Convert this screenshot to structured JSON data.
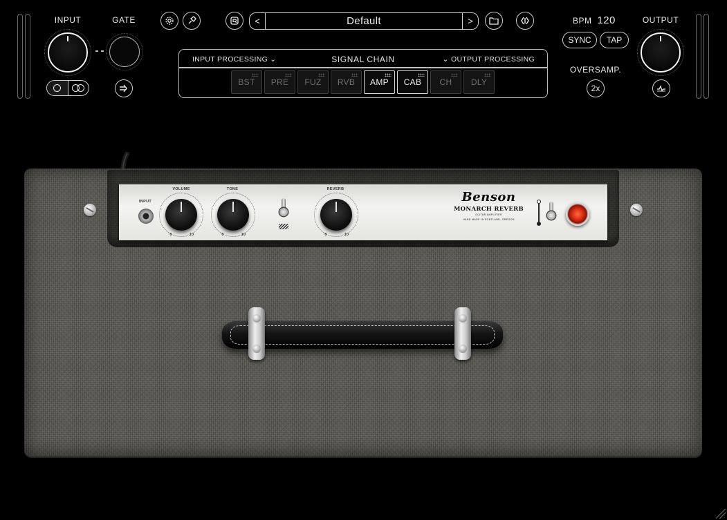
{
  "header": {
    "input_label": "INPUT",
    "gate_label": "GATE",
    "output_label": "OUTPUT",
    "bpm_label": "BPM",
    "bpm_value": "120",
    "sync_label": "SYNC",
    "tap_label": "TAP",
    "oversamp_label": "OVERSAMP.",
    "oversamp_value": "2x"
  },
  "preset": {
    "name": "Default",
    "prev_glyph": "<",
    "next_glyph": ">"
  },
  "signal_chain": {
    "title": "SIGNAL CHAIN",
    "input_processing_label": "INPUT PROCESSING ⌄",
    "output_processing_label": "⌄ OUTPUT PROCESSING",
    "modules": [
      {
        "label": "BST",
        "active": false
      },
      {
        "label": "PRE",
        "active": false
      },
      {
        "label": "FUZ",
        "active": false
      },
      {
        "label": "RVB",
        "active": false
      },
      {
        "label": "AMP",
        "active": true
      },
      {
        "label": "CAB",
        "active": true
      },
      {
        "label": "CH",
        "active": false
      },
      {
        "label": "DLY",
        "active": false
      }
    ]
  },
  "amp": {
    "input_label": "INPUT",
    "volume_label": "VOLUME",
    "tone_label": "TONE",
    "reverb_label": "REVERB",
    "brand": "Benson",
    "model": "MONARCH REVERB",
    "subtitle": "GUITAR AMPLIFIER",
    "made_in": "HAND MADE IN PORTLAND, OREGON",
    "scale_min": "0",
    "scale_max": "10"
  },
  "colors": {
    "background": "#000000",
    "tolex": "#5b5a55",
    "panel": "#ecece9",
    "pilot_light": "#d52a12",
    "active_module_border": "#d8d8d8"
  },
  "icons": {
    "settings": "gear-icon",
    "tuner": "tuning-fork-icon",
    "preset_manager": "preset-icon",
    "folder": "folder-icon",
    "brand_logo": "logo-icon",
    "mono": "mono-icon",
    "stereo": "stereo-icon",
    "gate_mode": "arrow-in-icon",
    "output_eq": "waveform-icon"
  }
}
